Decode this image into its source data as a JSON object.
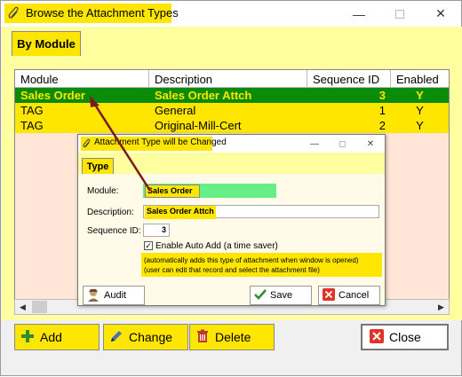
{
  "window": {
    "title": "Browse the Attachment Types",
    "controls": [
      "minimize",
      "maximize",
      "close"
    ]
  },
  "tab": {
    "label": "By Module"
  },
  "grid": {
    "columns": [
      "Module",
      "Description",
      "Sequence ID",
      "Enabled"
    ],
    "rows": [
      {
        "module": "Sales Order",
        "description": "Sales Order Attch",
        "sequence_id": "3",
        "enabled": "Y",
        "selected": true
      },
      {
        "module": "TAG",
        "description": "General",
        "sequence_id": "1",
        "enabled": "Y",
        "selected": false
      },
      {
        "module": "TAG",
        "description": "Original-Mill-Cert",
        "sequence_id": "2",
        "enabled": "Y",
        "selected": false
      }
    ]
  },
  "buttons": {
    "add": "Add",
    "change": "Change",
    "delete": "Delete",
    "close": "Close"
  },
  "dialog": {
    "title": "Attachment Type will be Changed",
    "tab": "Type",
    "module_label": "Module:",
    "module_value": "Sales Order",
    "description_label": "Description:",
    "description_value": "Sales Order Attch",
    "sequence_label": "Sequence ID:",
    "sequence_value": "3",
    "auto_add_checked": true,
    "auto_add_label": "Enable Auto Add  (a time saver)",
    "note_line1": "(automatically adds this type of attachment when window is opened)",
    "note_line2": "(user can edit that record and select the attachment file)",
    "audit": "Audit",
    "save": "Save",
    "cancel": "Cancel"
  },
  "colors": {
    "highlight_yellow": "#ffe600",
    "selected_row_green": "#0a8c0a",
    "panel_yellow": "#ffff9f",
    "grid_background": "#ffe6d6",
    "arrow": "#7a1a1a"
  }
}
